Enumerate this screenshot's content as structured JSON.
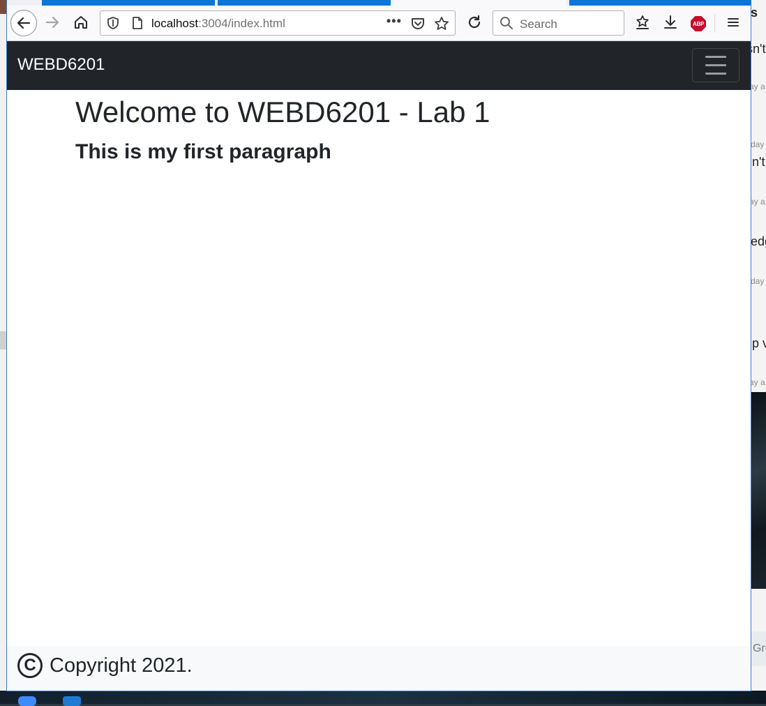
{
  "browser": {
    "url_host": "localhost",
    "url_rest": ":3004/index.html",
    "search_placeholder": "Search",
    "overflow_menu_dots": "•••",
    "addon_label": "ABP",
    "icons": {
      "back": "arrow-left-icon",
      "forward": "arrow-right-icon",
      "home": "home-icon",
      "tracking": "shield-icon",
      "page": "page-icon",
      "pocket": "pocket-icon",
      "bookmark": "star-icon",
      "reload": "reload-icon",
      "search": "search-icon",
      "bookmarks_menu": "bookmarks-star-icon",
      "downloads": "download-icon",
      "menu": "hamburger-icon"
    }
  },
  "navbar": {
    "brand": "WEBD6201"
  },
  "main": {
    "title": "Welcome to WEBD6201 - Lab 1",
    "paragraph": "This is my first paragraph"
  },
  "footer": {
    "copyright_symbol": "C",
    "copyright_text": "Copyright 2021."
  },
  "background": {
    "fragments": [
      "s",
      "sn't",
      "ay a",
      "day",
      "n't",
      "ay a",
      "edg",
      "day",
      "p v",
      "ay a",
      "Gro"
    ]
  },
  "colors": {
    "navbar_bg": "#212529",
    "footer_bg": "#f8f9fa",
    "text": "#212529",
    "tab_blue": "#0a76d8",
    "abp_red": "#c70d2c"
  }
}
